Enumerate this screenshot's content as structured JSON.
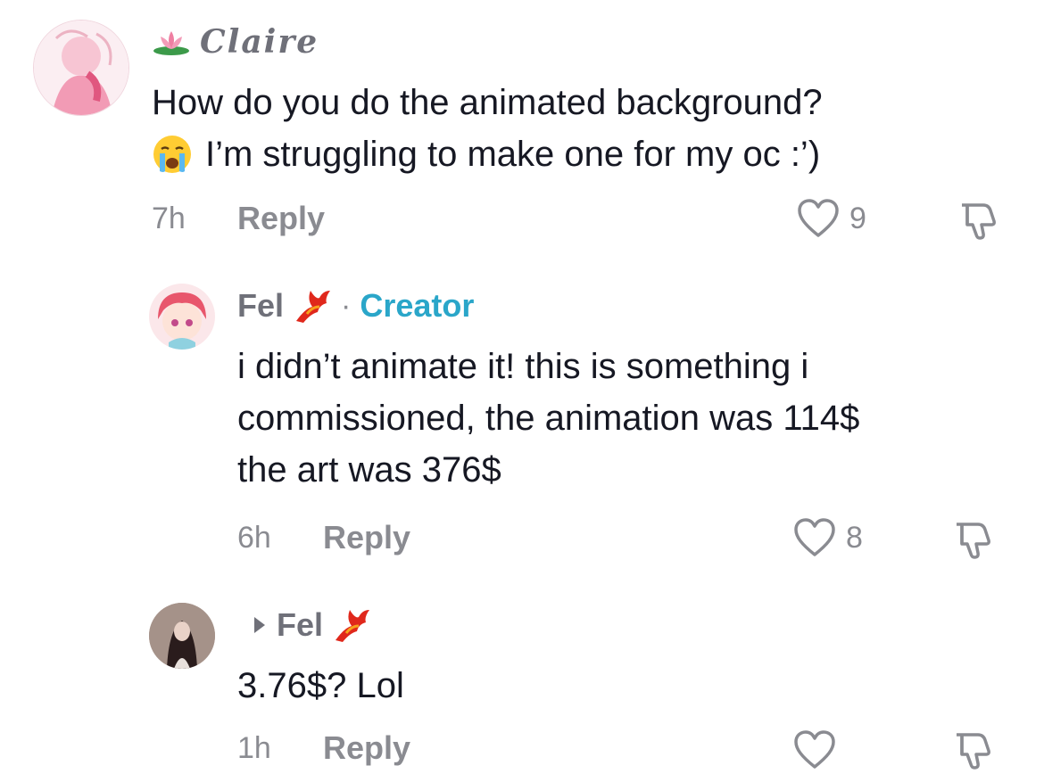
{
  "comments": [
    {
      "username": "Claire",
      "text_lines": [
        "How do you do the animated background?",
        "I’m struggling to make one for my oc :’)"
      ],
      "time": "7h",
      "reply_label": "Reply",
      "likes": "9"
    },
    {
      "username": "Fel",
      "separator": "·",
      "role": "Creator",
      "text_lines": [
        "i didn’t animate it! this is something i",
        "commissioned, the animation was 114$",
        "the art was 376$"
      ],
      "time": "6h",
      "reply_label": "Reply",
      "likes": "8"
    },
    {
      "reply_to": "Fel",
      "text_lines": [
        "3.76$? Lol"
      ],
      "time": "1h",
      "reply_label": "Reply",
      "likes": ""
    }
  ],
  "colors": {
    "text": "#161823",
    "muted": "#8a8b91",
    "creator": "#2aa6c9"
  },
  "icons": [
    "lotus-icon",
    "crying-face-emoji",
    "heart-icon",
    "dislike-icon",
    "phoenix-icon",
    "reply-arrow-icon"
  ]
}
